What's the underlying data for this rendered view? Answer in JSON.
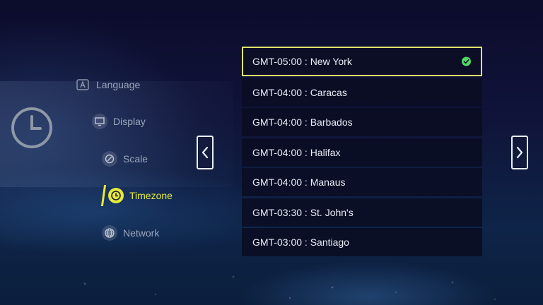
{
  "settings_menu": {
    "items": [
      {
        "label": "Language",
        "icon": "language-icon"
      },
      {
        "label": "Display",
        "icon": "display-icon"
      },
      {
        "label": "Scale",
        "icon": "scale-icon"
      },
      {
        "label": "Timezone",
        "icon": "clock-icon",
        "active": true
      },
      {
        "label": "Network",
        "icon": "network-icon"
      }
    ]
  },
  "category_icon": "clock-icon",
  "navigation": {
    "prev_icon": "chevron-left-icon",
    "next_icon": "chevron-right-icon"
  },
  "timezones": {
    "items": [
      {
        "label": "GMT-05:00 : New York",
        "selected": true
      },
      {
        "label": "GMT-04:00 : Caracas"
      },
      {
        "label": "GMT-04:00 : Barbados"
      },
      {
        "label": "GMT-04:00 : Halifax"
      },
      {
        "label": "GMT-04:00 : Manaus"
      },
      {
        "label": "GMT-03:30 : St. John's"
      },
      {
        "label": "GMT-03:00 : Santiago"
      }
    ],
    "selected_indicator_icon": "check-circle-icon"
  },
  "colors": {
    "accent": "#e6ea3a",
    "selected_border": "#dfe36a",
    "check": "#4cd964",
    "text": "#e9edf5",
    "menu_text": "#9aa6bd"
  }
}
